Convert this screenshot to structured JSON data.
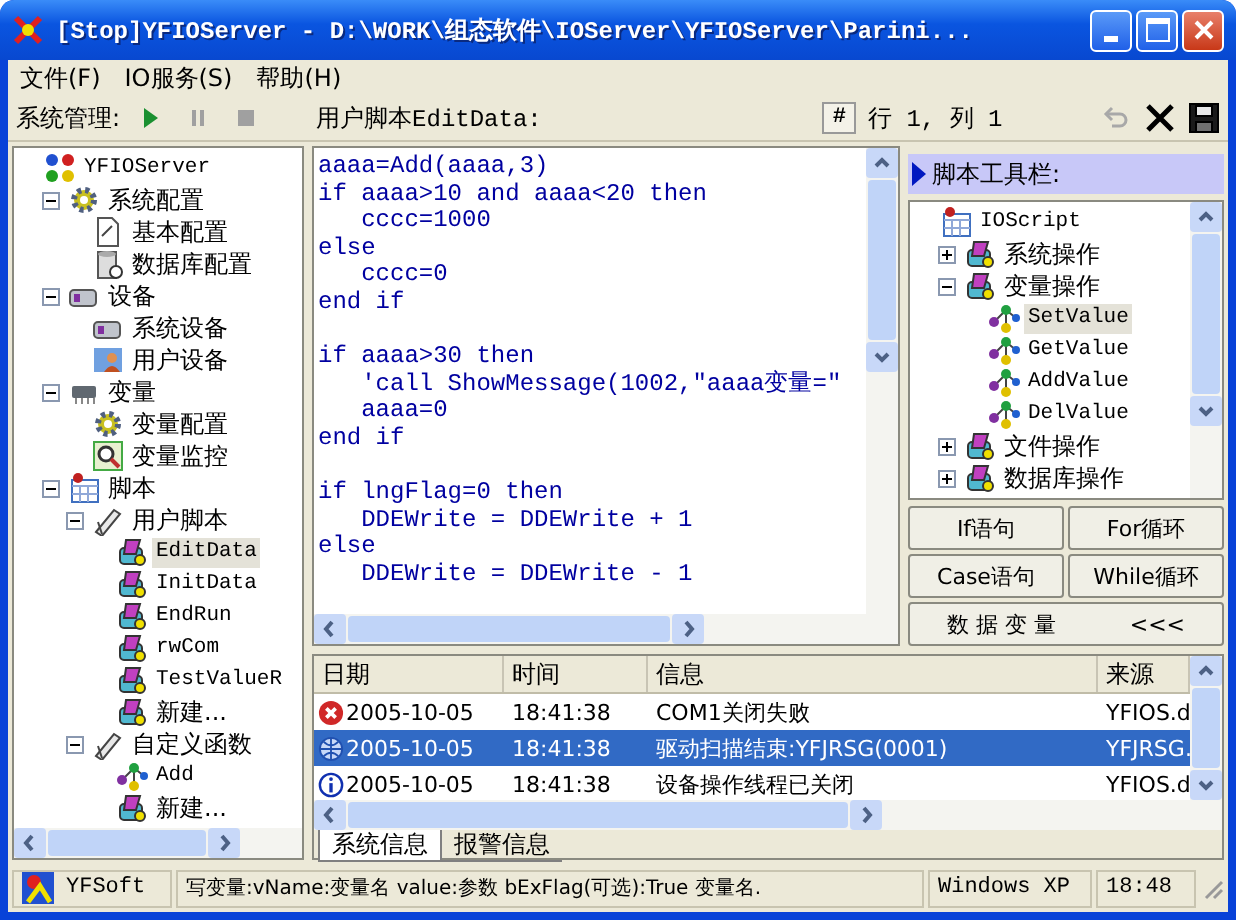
{
  "window": {
    "title": "[Stop]YFIOServer - D:\\WORK\\组态软件\\IOServer\\YFIOServer\\Parini..."
  },
  "menu": [
    "文件(F)",
    "IO服务(S)",
    "帮助(H)"
  ],
  "toolbar": {
    "label": "系统管理:",
    "tools": [
      {
        "kind": "play",
        "disabled": false
      },
      {
        "kind": "pause",
        "disabled": true
      },
      {
        "kind": "stop",
        "disabled": true
      }
    ],
    "script_title": "用户脚本EditData:",
    "hash_button": "#",
    "position": "行 1, 列 1",
    "undo_disabled": true
  },
  "tree": [
    {
      "label": "YFIOServer",
      "kind": "app",
      "selected": false,
      "children": [
        {
          "label": "系统配置",
          "kind": "gear",
          "selected": false,
          "expanded": true,
          "children": [
            {
              "label": "基本配置",
              "kind": "doc",
              "selected": false
            },
            {
              "label": "数据库配置",
              "kind": "database",
              "selected": false
            }
          ]
        },
        {
          "label": "设备",
          "kind": "device",
          "selected": false,
          "expanded": true,
          "children": [
            {
              "label": "系统设备",
              "kind": "device",
              "selected": false
            },
            {
              "label": "用户设备",
              "kind": "user",
              "selected": false
            }
          ]
        },
        {
          "label": "变量",
          "kind": "chip",
          "selected": false,
          "expanded": true,
          "children": [
            {
              "label": "变量配置",
              "kind": "gear",
              "selected": false
            },
            {
              "label": "变量监控",
              "kind": "magnifier",
              "selected": false
            }
          ]
        },
        {
          "label": "脚本",
          "kind": "calendar",
          "selected": false,
          "expanded": true,
          "children": [
            {
              "label": "用户脚本",
              "kind": "pen",
              "selected": false,
              "expanded": true,
              "children": [
                {
                  "label": "EditData",
                  "kind": "script",
                  "selected": true
                },
                {
                  "label": "InitData",
                  "kind": "script",
                  "selected": false
                },
                {
                  "label": "EndRun",
                  "kind": "script",
                  "selected": false
                },
                {
                  "label": "rwCom",
                  "kind": "script",
                  "selected": false
                },
                {
                  "label": "TestValueR",
                  "kind": "script",
                  "selected": false
                },
                {
                  "label": "新建...",
                  "kind": "script",
                  "selected": false
                }
              ]
            },
            {
              "label": "自定义函数",
              "kind": "pen",
              "selected": false,
              "expanded": true,
              "children": [
                {
                  "label": "Add",
                  "kind": "nodes",
                  "selected": false
                },
                {
                  "label": "新建...",
                  "kind": "script",
                  "selected": false
                }
              ]
            }
          ]
        }
      ]
    }
  ],
  "editor": {
    "blocks": [
      [
        "aaaa=Add(aaaa,3)",
        "if aaaa>10 and aaaa<20 then",
        "   cccc=1000",
        "else",
        "   cccc=0",
        "end if"
      ],
      [
        "if aaaa>30 then",
        "   'call ShowMessage(1002,\"aaaa变量=\"",
        "   aaaa=0",
        "end if"
      ],
      [
        "if lngFlag=0 then",
        "   DDEWrite = DDEWrite + 1",
        "else",
        "   DDEWrite = DDEWrite - 1"
      ]
    ]
  },
  "script_toolbox": {
    "header": "脚本工具栏:",
    "tree": [
      {
        "label": "IOScript",
        "kind": "calendar",
        "selected": false,
        "children": [
          {
            "label": "系统操作",
            "kind": "script",
            "selected": false,
            "expanded": false
          },
          {
            "label": "变量操作",
            "kind": "script",
            "selected": false,
            "expanded": true,
            "children": [
              {
                "label": "SetValue",
                "kind": "nodes",
                "selected": true
              },
              {
                "label": "GetValue",
                "kind": "nodes",
                "selected": false
              },
              {
                "label": "AddValue",
                "kind": "nodes",
                "selected": false
              },
              {
                "label": "DelValue",
                "kind": "nodes",
                "selected": false
              }
            ]
          },
          {
            "label": "文件操作",
            "kind": "script",
            "selected": false,
            "expanded": false
          },
          {
            "label": "数据库操作",
            "kind": "script",
            "selected": false,
            "expanded": false
          }
        ]
      }
    ],
    "buttons": [
      "If语句",
      "For循环",
      "Case语句",
      "While循环"
    ],
    "wide_button": {
      "label": "数 据 变 量",
      "arrow": "<<<"
    }
  },
  "log": {
    "columns": [
      "日期",
      "时间",
      "信息",
      "来源"
    ],
    "rows": [
      {
        "kind": "error",
        "date": "2005-10-05",
        "time": "18:41:38",
        "message": "COM1关闭失败",
        "source": "YFIOS.d",
        "selected": false
      },
      {
        "kind": "driver",
        "date": "2005-10-05",
        "time": "18:41:38",
        "message": "驱动扫描结束:YFJRSG(0001)",
        "source": "YFJRSG.",
        "selected": true
      },
      {
        "kind": "info",
        "date": "2005-10-05",
        "time": "18:41:38",
        "message": "设备操作线程已关闭",
        "source": "YFIOS.d",
        "selected": false
      }
    ],
    "tabs": [
      {
        "label": "系统信息",
        "selected": true
      },
      {
        "label": "报警信息",
        "selected": false
      }
    ]
  },
  "status_bar": {
    "app": "YFSoft",
    "hint": "写变量:vName:变量名 value:参数 bExFlag(可选):True 变量名.",
    "os": "Windows XP",
    "time": "18:48"
  }
}
